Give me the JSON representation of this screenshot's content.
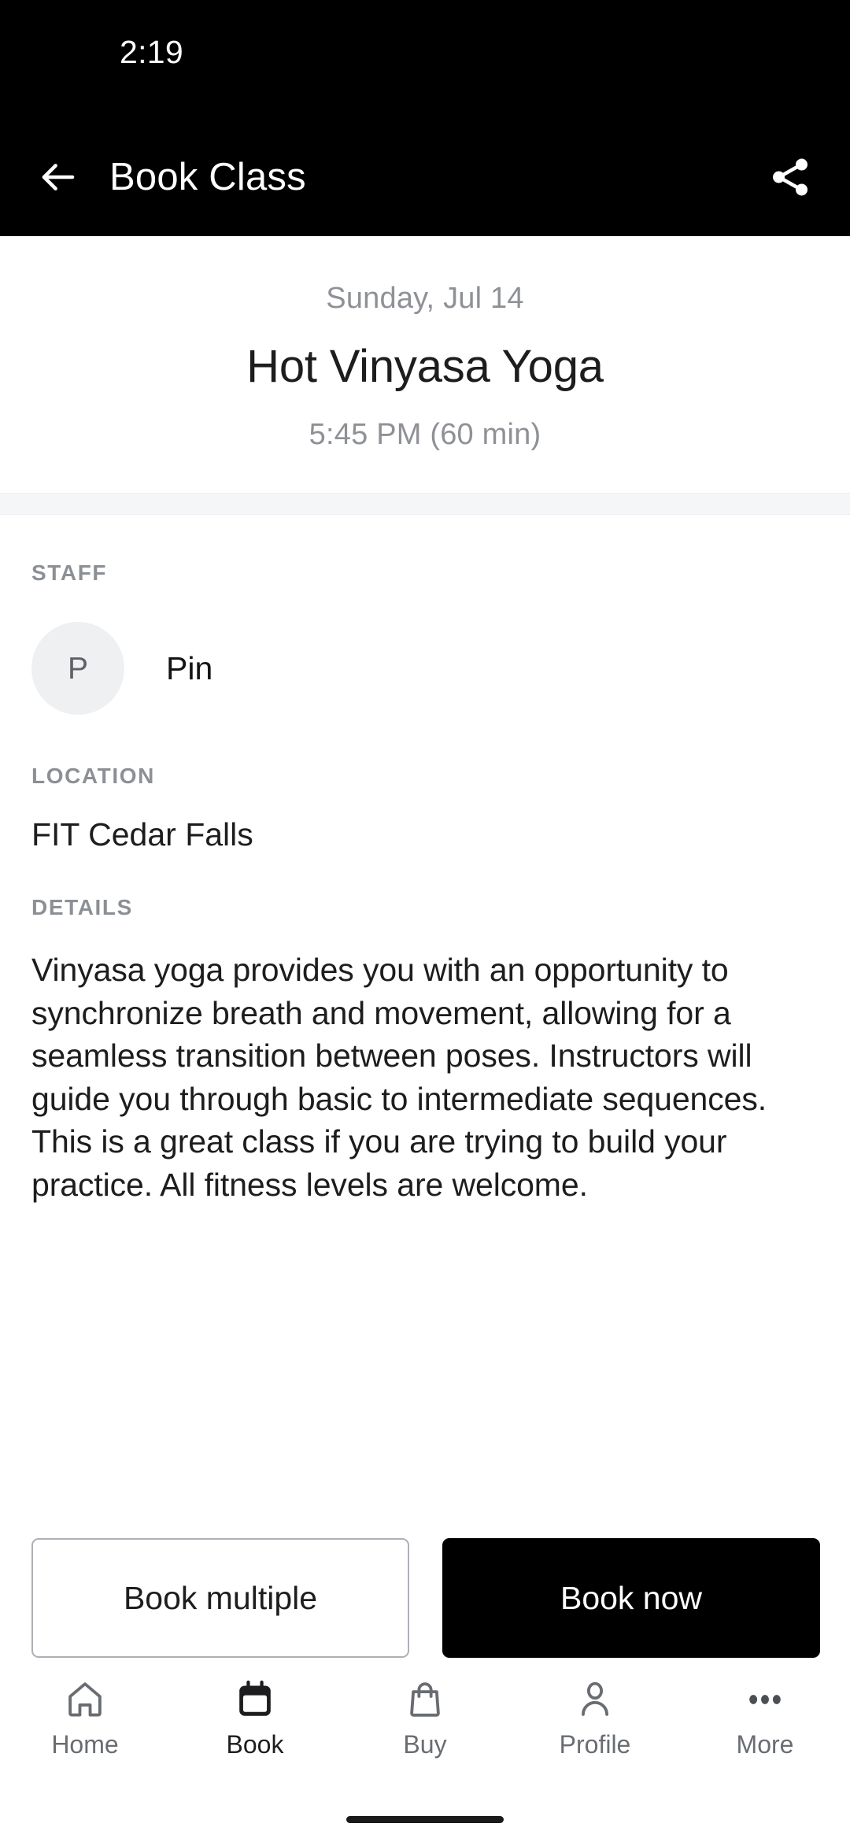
{
  "status_bar": {
    "clock": "2:19"
  },
  "app_bar": {
    "back_icon": "arrow-left-icon",
    "title": "Book Class",
    "share_icon": "share-icon"
  },
  "class_header": {
    "date": "Sunday, Jul 14",
    "title": "Hot Vinyasa Yoga",
    "time": "5:45 PM (60 min)"
  },
  "staff": {
    "label": "STAFF",
    "avatar_initial": "P",
    "name": "Pin"
  },
  "location": {
    "label": "LOCATION",
    "value": "FIT Cedar Falls"
  },
  "details": {
    "label": "DETAILS",
    "text": "Vinyasa yoga provides you with an opportunity to synchronize breath and movement, allowing for a seamless transition between poses. Instructors will guide you through basic to intermediate sequences. This is a great class if you are trying to build your practice. All fitness levels are welcome."
  },
  "actions": {
    "book_multiple_label": "Book multiple",
    "book_now_label": "Book now"
  },
  "bottom_nav": {
    "items": [
      {
        "label": "Home",
        "icon": "home-icon",
        "active": false
      },
      {
        "label": "Book",
        "icon": "calendar-icon",
        "active": true
      },
      {
        "label": "Buy",
        "icon": "bag-icon",
        "active": false
      },
      {
        "label": "Profile",
        "icon": "person-icon",
        "active": false
      },
      {
        "label": "More",
        "icon": "ellipsis-icon",
        "active": false
      }
    ]
  },
  "colors": {
    "app_bar_background": "#000000",
    "page_background": "#ffffff",
    "primary_text": "#1d1d1f",
    "muted_text": "#8e9196",
    "section_label": "#8c9095",
    "separator_band": "#f5f6f8",
    "avatar_background": "#eef0f2",
    "button_border": "#adb0b5",
    "button_filled": "#000000",
    "nav_inactive": "#696d72",
    "nav_active": "#1d1d1f"
  }
}
